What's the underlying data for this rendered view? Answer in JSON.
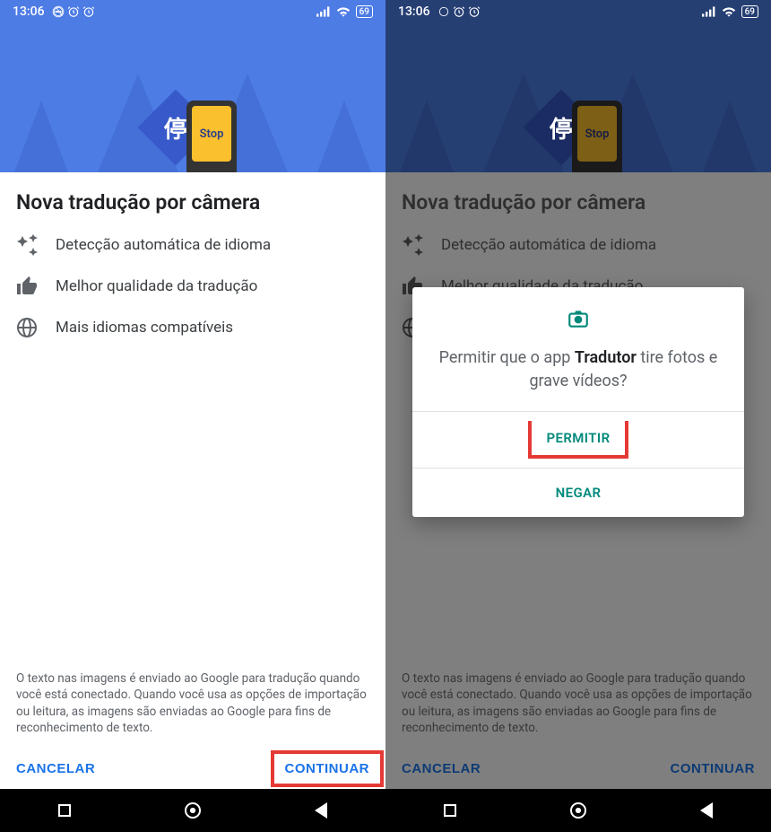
{
  "statusbar": {
    "time": "13:06",
    "battery": "69"
  },
  "hero": {
    "char": "停",
    "stop_label": "Stop"
  },
  "title": "Nova tradução por câmera",
  "features": [
    "Detecção automática de idioma",
    "Melhor qualidade da tradução",
    "Mais idiomas compatíveis"
  ],
  "disclaimer": "O texto nas imagens é enviado ao Google para tradução quando você está conectado. Quando você usa as opções de importação ou leitura, as imagens são enviadas ao Google para fins de reconhecimento de texto.",
  "actions": {
    "cancel": "CANCELAR",
    "continue": "CONTINUAR"
  },
  "dialog": {
    "prefix": "Permitir que o app ",
    "app_name": "Tradutor",
    "suffix": " tire fotos e grave vídeos?",
    "allow": "PERMITIR",
    "deny": "NEGAR"
  }
}
